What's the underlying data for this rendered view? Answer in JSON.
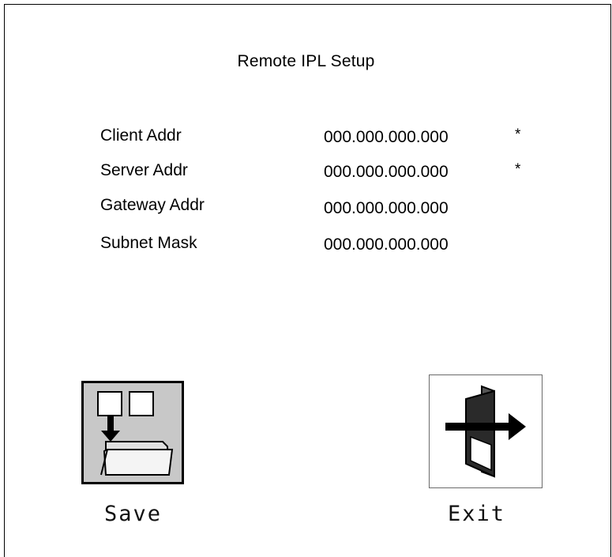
{
  "window": {
    "title": "Remote IPL Setup"
  },
  "fields": [
    {
      "label": "Client Addr",
      "value": "000.000.000.000",
      "required": "*"
    },
    {
      "label": "Server Addr",
      "value": "000.000.000.000",
      "required": "*"
    },
    {
      "label": "Gateway Addr",
      "value": "000.000.000.000",
      "required": ""
    },
    {
      "label": "Subnet Mask",
      "value": "000.000.000.000",
      "required": ""
    }
  ],
  "actions": {
    "save": {
      "label": "Save",
      "icon": "save-folder-icon"
    },
    "exit": {
      "label": "Exit",
      "icon": "exit-door-icon"
    }
  },
  "colors": {
    "save_icon_bg": "#c8c8c8",
    "border": "#000000"
  }
}
